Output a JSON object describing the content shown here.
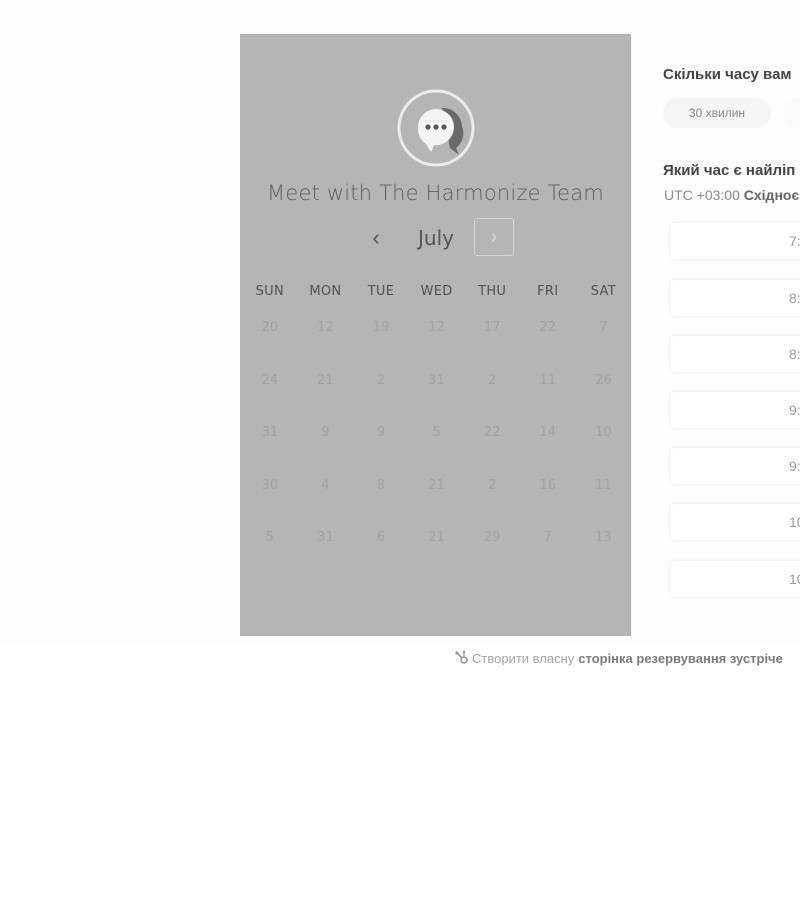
{
  "calendar": {
    "title": "Meet with The Harmonize Team",
    "month": "July",
    "prev_glyph": "‹",
    "next_glyph": "›",
    "weekdays": [
      "SUN",
      "MON",
      "TUE",
      "WED",
      "THU",
      "FRI",
      "SAT"
    ],
    "days": [
      "20",
      "12",
      "19",
      "12",
      "17",
      "22",
      "7",
      "24",
      "21",
      "2",
      "31",
      "2",
      "11",
      "26",
      "31",
      "9",
      "9",
      "5",
      "22",
      "14",
      "10",
      "30",
      "4",
      "8",
      "21",
      "2",
      "16",
      "11",
      "5",
      "31",
      "6",
      "21",
      "29",
      "7",
      "13"
    ]
  },
  "booking": {
    "duration_question": "Скільки часу вам",
    "duration_option": "30 хвилин",
    "time_question": "Який час є найліп",
    "timezone_prefix": "UTC +03:00",
    "timezone_name": "Східноє",
    "slots": [
      "7:",
      "8:",
      "8:",
      "9:",
      "9:",
      "10",
      "10"
    ]
  },
  "footer": {
    "text": "Створити власну",
    "link": "сторінка резервування зустріче"
  },
  "colors": {
    "panel_overlay": "#b5b5b5",
    "logo_accent": "#6a6a6a"
  },
  "icons": {
    "logo": "chat-bubble-logo-icon",
    "prev": "chevron-left-icon",
    "next": "chevron-right-icon",
    "footer": "sprocket-icon"
  }
}
